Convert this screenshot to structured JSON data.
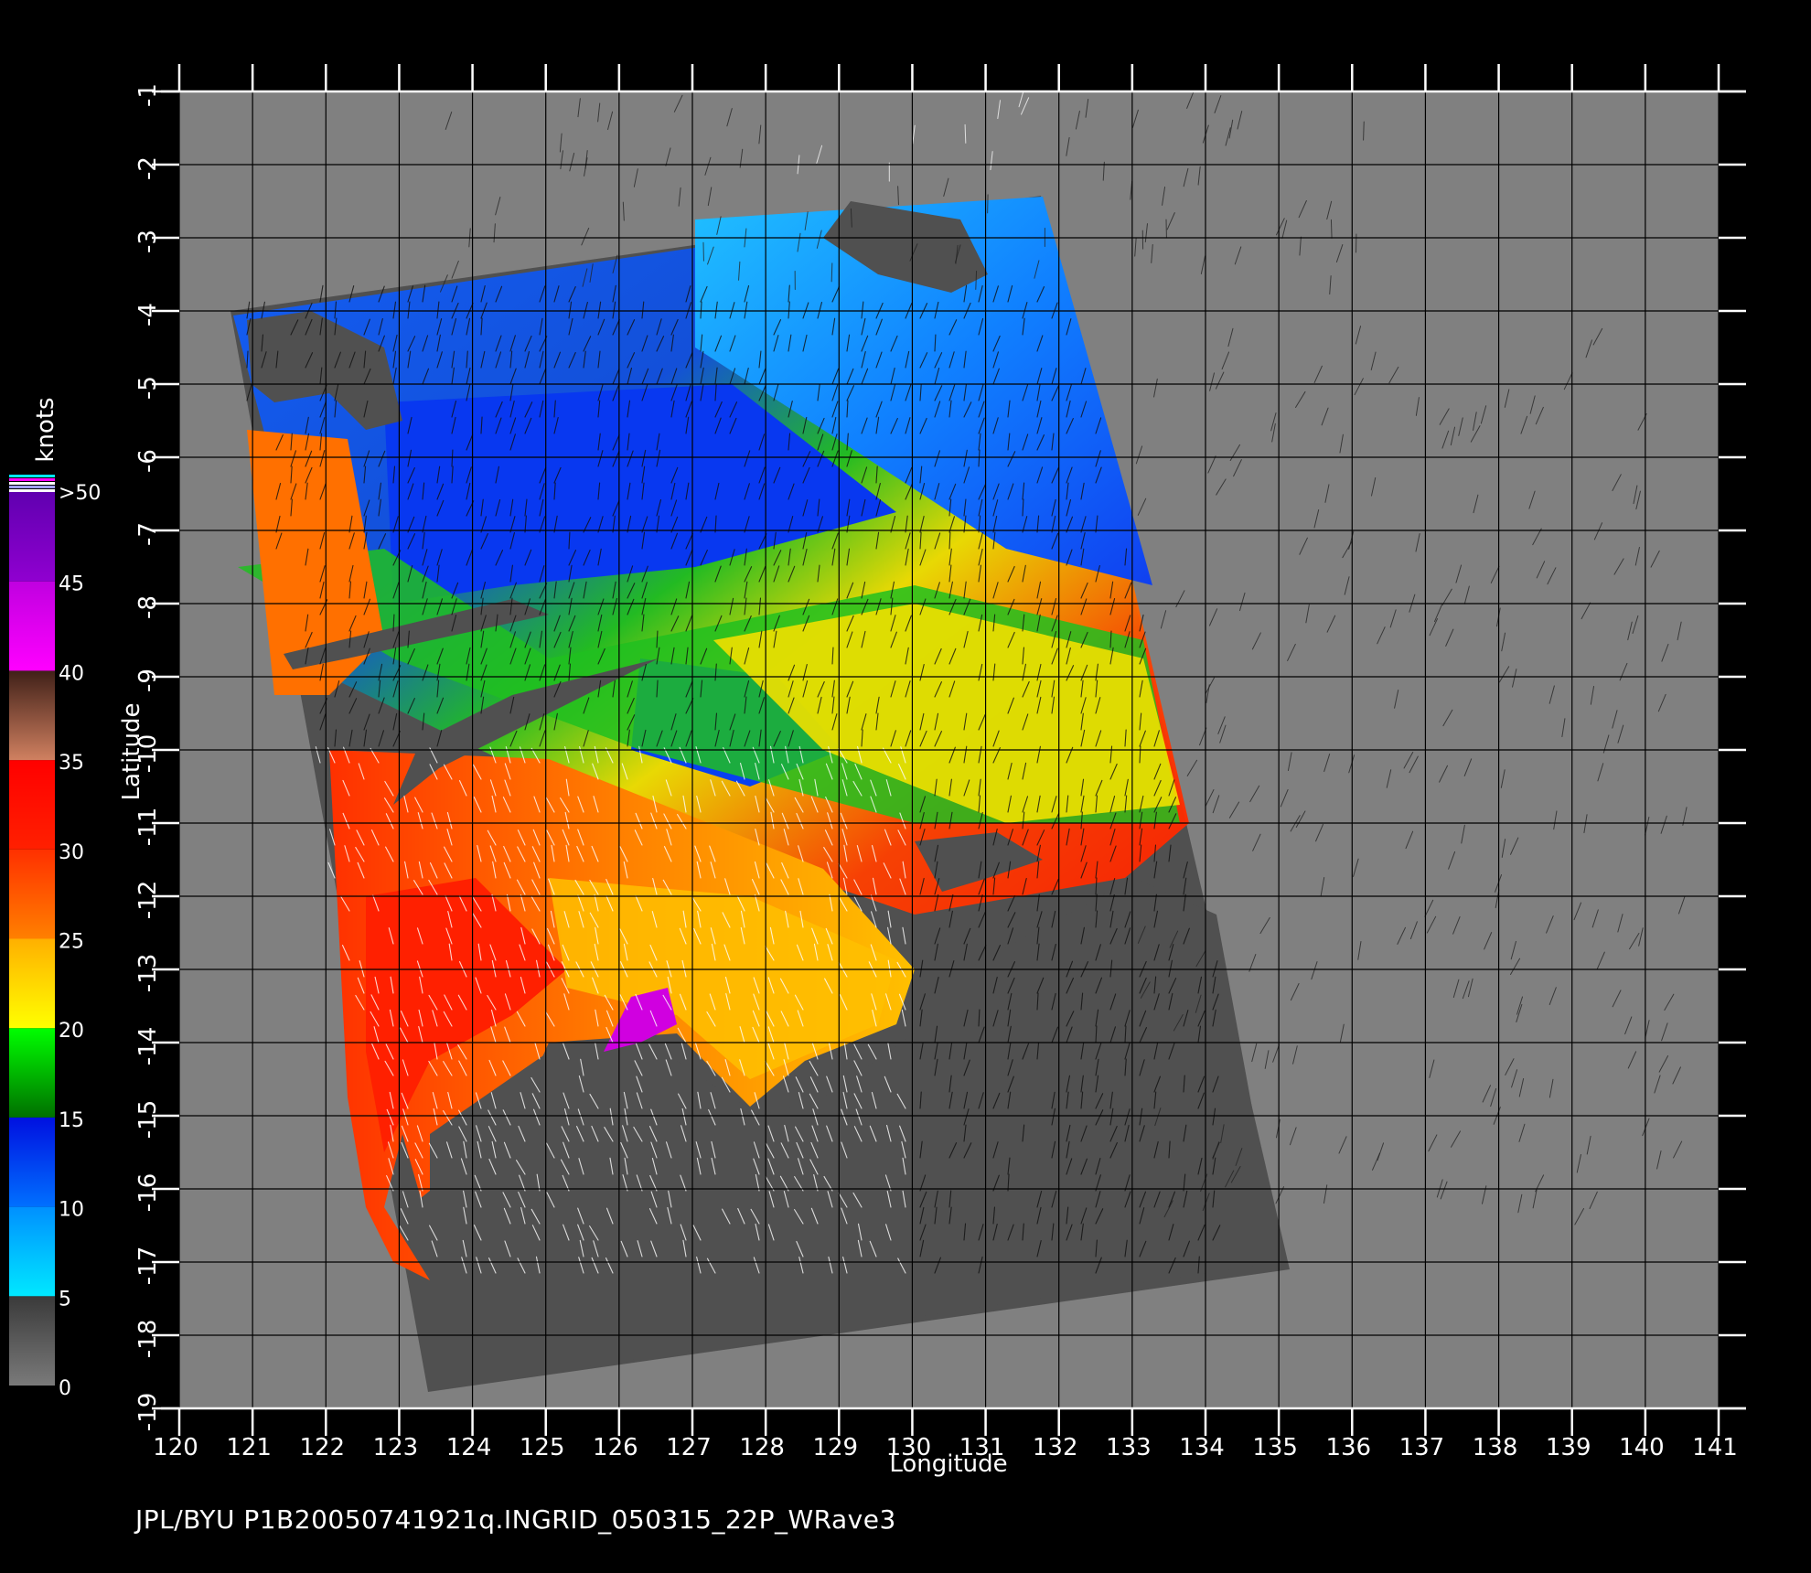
{
  "colors": {
    "background": "#000000",
    "land": "#808080",
    "swath_no_data": "#505050"
  },
  "map": {
    "lon_range": [
      120,
      141
    ],
    "lat_range": [
      -19,
      -1
    ],
    "lon_ticks": [
      "120",
      "121",
      "122",
      "123",
      "124",
      "125",
      "126",
      "127",
      "128",
      "129",
      "130",
      "131",
      "132",
      "133",
      "134",
      "135",
      "136",
      "137",
      "138",
      "139",
      "140",
      "141"
    ],
    "lat_ticks": [
      "-1",
      "-2",
      "-3",
      "-4",
      "-5",
      "-6",
      "-7",
      "-8",
      "-9",
      "-10",
      "-11",
      "-12",
      "-13",
      "-14",
      "-15",
      "-16",
      "-17",
      "-18",
      "-19"
    ],
    "xlabel": "Longitude",
    "ylabel": "Latitude",
    "grid": true
  },
  "colorbar": {
    "unit": "knots",
    "labels": [
      "0",
      "5",
      "10",
      "15",
      "20",
      "25",
      "30",
      "35",
      "40",
      "45",
      ">50"
    ],
    "stops": [
      {
        "from": 0,
        "to": 5,
        "colors": [
          "#7a7a7a",
          "#3a3a3a"
        ]
      },
      {
        "from": 5,
        "to": 10,
        "colors": [
          "#00e8ff",
          "#0090ff"
        ]
      },
      {
        "from": 10,
        "to": 15,
        "colors": [
          "#0070ff",
          "#0010e0"
        ]
      },
      {
        "from": 15,
        "to": 20,
        "colors": [
          "#007000",
          "#00ff00"
        ]
      },
      {
        "from": 20,
        "to": 25,
        "colors": [
          "#ffff00",
          "#ffb000"
        ]
      },
      {
        "from": 25,
        "to": 30,
        "colors": [
          "#ff8000",
          "#ff3000"
        ]
      },
      {
        "from": 30,
        "to": 35,
        "colors": [
          "#ff2000",
          "#ff0000"
        ]
      },
      {
        "from": 35,
        "to": 40,
        "colors": [
          "#d08060",
          "#402018"
        ]
      },
      {
        "from": 40,
        "to": 45,
        "colors": [
          "#ff00ff",
          "#c000e0"
        ]
      },
      {
        "from": 45,
        "to": 50,
        "colors": [
          "#9000d0",
          "#6000b0"
        ]
      }
    ]
  },
  "footer": {
    "text": "JPL/BYU  P1B20050741921q.INGRID_050315_22P_WRave3"
  }
}
